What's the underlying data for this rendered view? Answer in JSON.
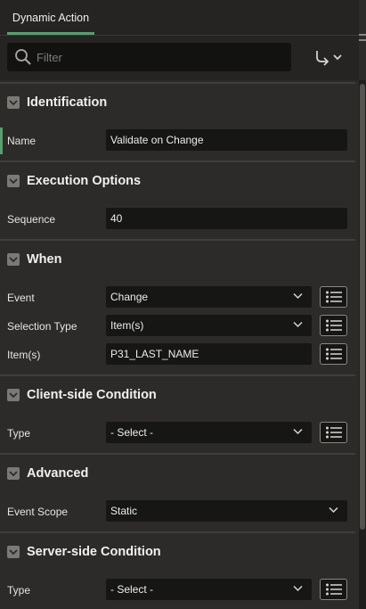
{
  "tab": {
    "label": "Dynamic Action"
  },
  "filter": {
    "placeholder": "Filter"
  },
  "sections": {
    "identification": {
      "title": "Identification",
      "name_label": "Name",
      "name_value": "Validate on Change"
    },
    "execution": {
      "title": "Execution Options",
      "sequence_label": "Sequence",
      "sequence_value": "40"
    },
    "when": {
      "title": "When",
      "event_label": "Event",
      "event_value": "Change",
      "selection_type_label": "Selection Type",
      "selection_type_value": "Item(s)",
      "items_label": "Item(s)",
      "items_value": "P31_LAST_NAME"
    },
    "client_condition": {
      "title": "Client-side Condition",
      "type_label": "Type",
      "type_value": "- Select -"
    },
    "advanced": {
      "title": "Advanced",
      "event_scope_label": "Event Scope",
      "event_scope_value": "Static"
    },
    "server_condition": {
      "title": "Server-side Condition",
      "type_label": "Type",
      "type_value": "- Select -"
    }
  },
  "colors": {
    "accent": "#5b9e6f",
    "background": "#2c2b29",
    "field": "#161615"
  }
}
